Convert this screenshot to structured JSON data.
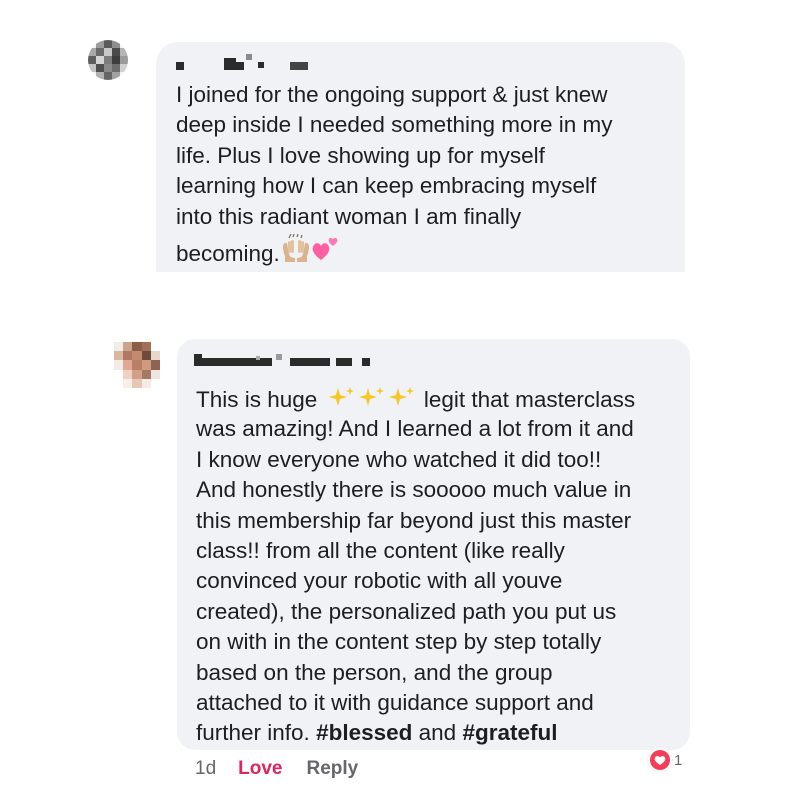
{
  "comments": [
    {
      "lines": [
        "I joined for the ongoing support & just knew",
        "deep inside I needed something more in my",
        "life. Plus I love showing up for myself",
        "learning how I can keep embracing myself",
        "into this radiant woman I am finally",
        "becoming."
      ],
      "emojis": [
        "raising-hands-emoji",
        "two-hearts-emoji"
      ]
    },
    {
      "line1_start": "This is huge",
      "line1_end": "legit that masterclass",
      "sparkle_icon": "sparkles-emoji",
      "lines": [
        "was amazing! And I learned a lot from it and",
        "I know everyone who watched it did too!!",
        "And honestly there is sooooo much value in",
        "this membership far beyond just this master",
        "class!!  from all the content (like really",
        "convinced your robotic with all youve",
        "created), the personalized path you put us",
        "on with in the content step by step totally",
        "based on the person, and the group",
        "attached to it with guidance support and"
      ],
      "last_line_text": "further info.",
      "hashtag1": "#blessed",
      "and_text": "and",
      "hashtag2": "#grateful",
      "time": "1d",
      "love_label": "Love",
      "reply_label": "Reply",
      "reaction_icon": "heart-reaction-icon",
      "reaction_count": "1"
    }
  ],
  "colors": {
    "bubble": "#f0f2f5",
    "love": "#e0245e",
    "meta": "#65676b"
  }
}
